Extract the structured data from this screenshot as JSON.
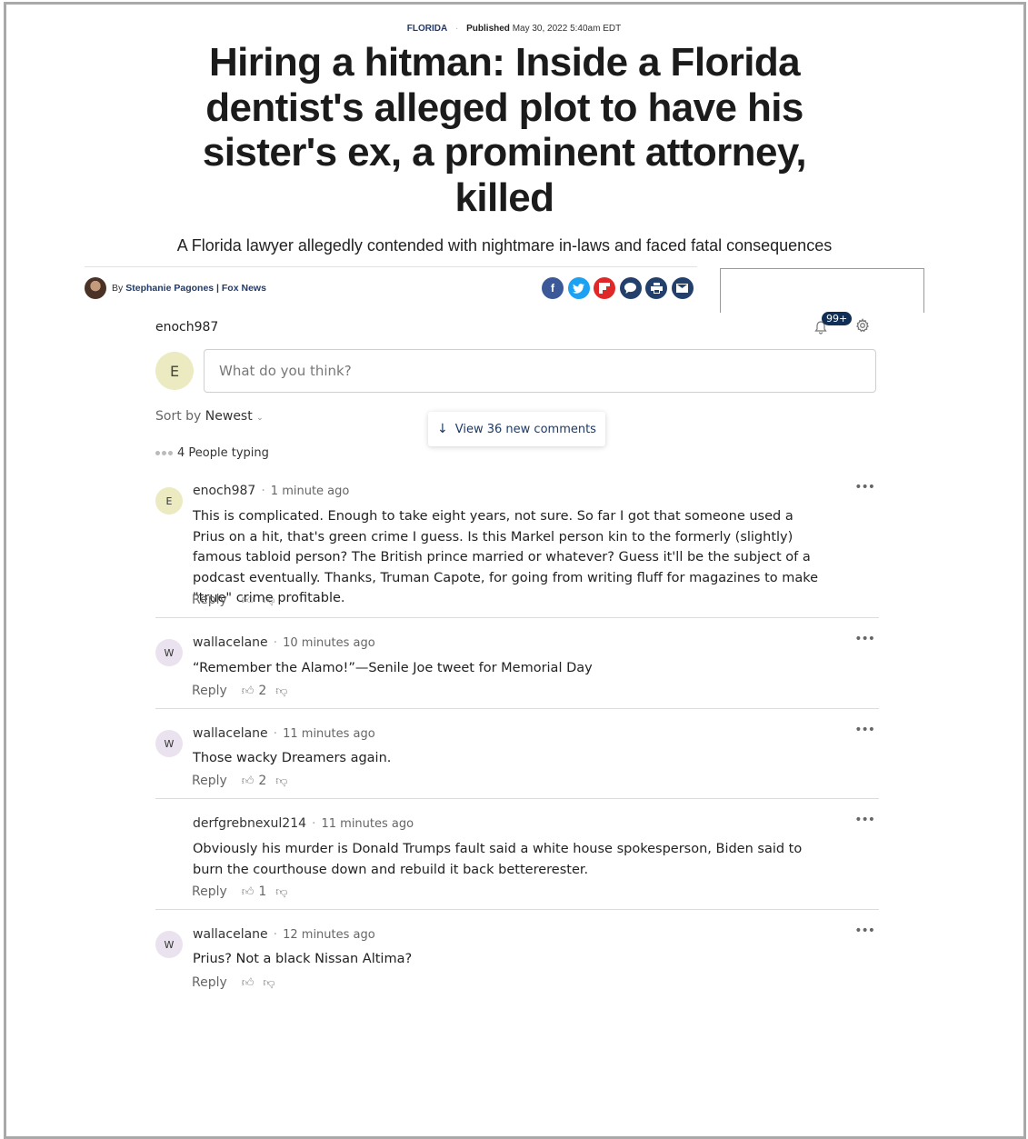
{
  "article": {
    "category": "FLORIDA",
    "published_label": "Published",
    "published_date": "May 30, 2022 5:40am EDT",
    "title": "Hiring a hitman: Inside a Florida dentist's alleged plot to have his sister's ex, a prominent attorney, killed",
    "subtitle": "A Florida lawyer allegedly contended with nightmare in-laws and faced fatal consequences",
    "byline_prefix": "By",
    "author": "Stephanie Pagones | Fox News",
    "share_icons": [
      "facebook-icon",
      "twitter-icon",
      "flipboard-icon",
      "comments-icon",
      "print-icon",
      "email-icon"
    ]
  },
  "comments_widget": {
    "current_user": "enoch987",
    "avatar_initial": "E",
    "notification_badge": "99+",
    "input_placeholder": "What do you think?",
    "sort_label": "Sort by",
    "sort_value": "Newest",
    "new_comments_label": "View 36 new comments",
    "typing_label": "4 People typing",
    "reply_label": "Reply",
    "comments": [
      {
        "initial": "E",
        "user": "enoch987",
        "time": "1 minute ago",
        "text": "This is complicated.  Enough to take eight years, not sure.  So far I got that someone used a Prius on a hit, that's green crime I guess.  Is this Markel person kin to the formerly (slightly) famous tabloid person?  The British prince married or whatever?  Guess it'll be the subject of a podcast eventually.  Thanks, Truman Capote, for going from writing fluff for magazines to make \"true\" crime profitable.",
        "likes": ""
      },
      {
        "initial": "W",
        "user": "wallacelane",
        "time": "10 minutes ago",
        "text": "“Remember the Alamo!”—Senile Joe tweet for Memorial Day",
        "likes": "2"
      },
      {
        "initial": "W",
        "user": "wallacelane",
        "time": "11 minutes ago",
        "text": "Those wacky Dreamers again.",
        "likes": "2"
      },
      {
        "initial": "",
        "user": "derfgrebnexul214",
        "time": "11 minutes ago",
        "text": "Obviously his murder is Donald Trumps fault said a white house spokesperson, Biden said to burn the courthouse down and rebuild it back betterer​ester.",
        "likes": "1"
      },
      {
        "initial": "W",
        "user": "wallacelane",
        "time": "12 minutes ago",
        "text": "Prius? Not a black Nissan Altima?",
        "likes": ""
      }
    ]
  }
}
